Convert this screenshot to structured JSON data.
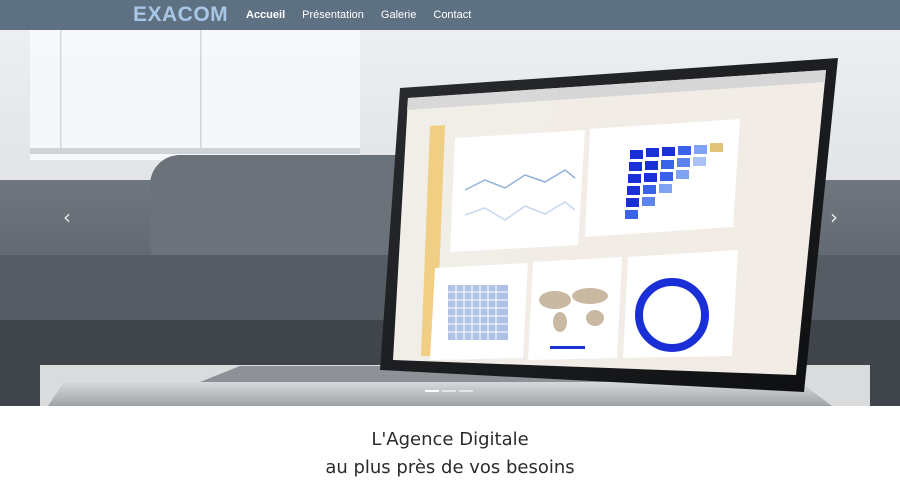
{
  "brand": {
    "name": "EXACOM",
    "color": "#a8c6e6"
  },
  "nav": {
    "background": "#5e7183",
    "items": [
      {
        "label": "Accueil",
        "active": true
      },
      {
        "label": "Présentation",
        "active": false
      },
      {
        "label": "Galerie",
        "active": false
      },
      {
        "label": "Contact",
        "active": false
      }
    ]
  },
  "carousel": {
    "image": "laptop-analytics-dashboard",
    "prev_icon": "‹",
    "next_icon": "›",
    "slide_count": 3,
    "active_slide": 1
  },
  "tagline": {
    "line1": "L'Agence Digitale",
    "line2": "au plus près de vos besoins"
  }
}
